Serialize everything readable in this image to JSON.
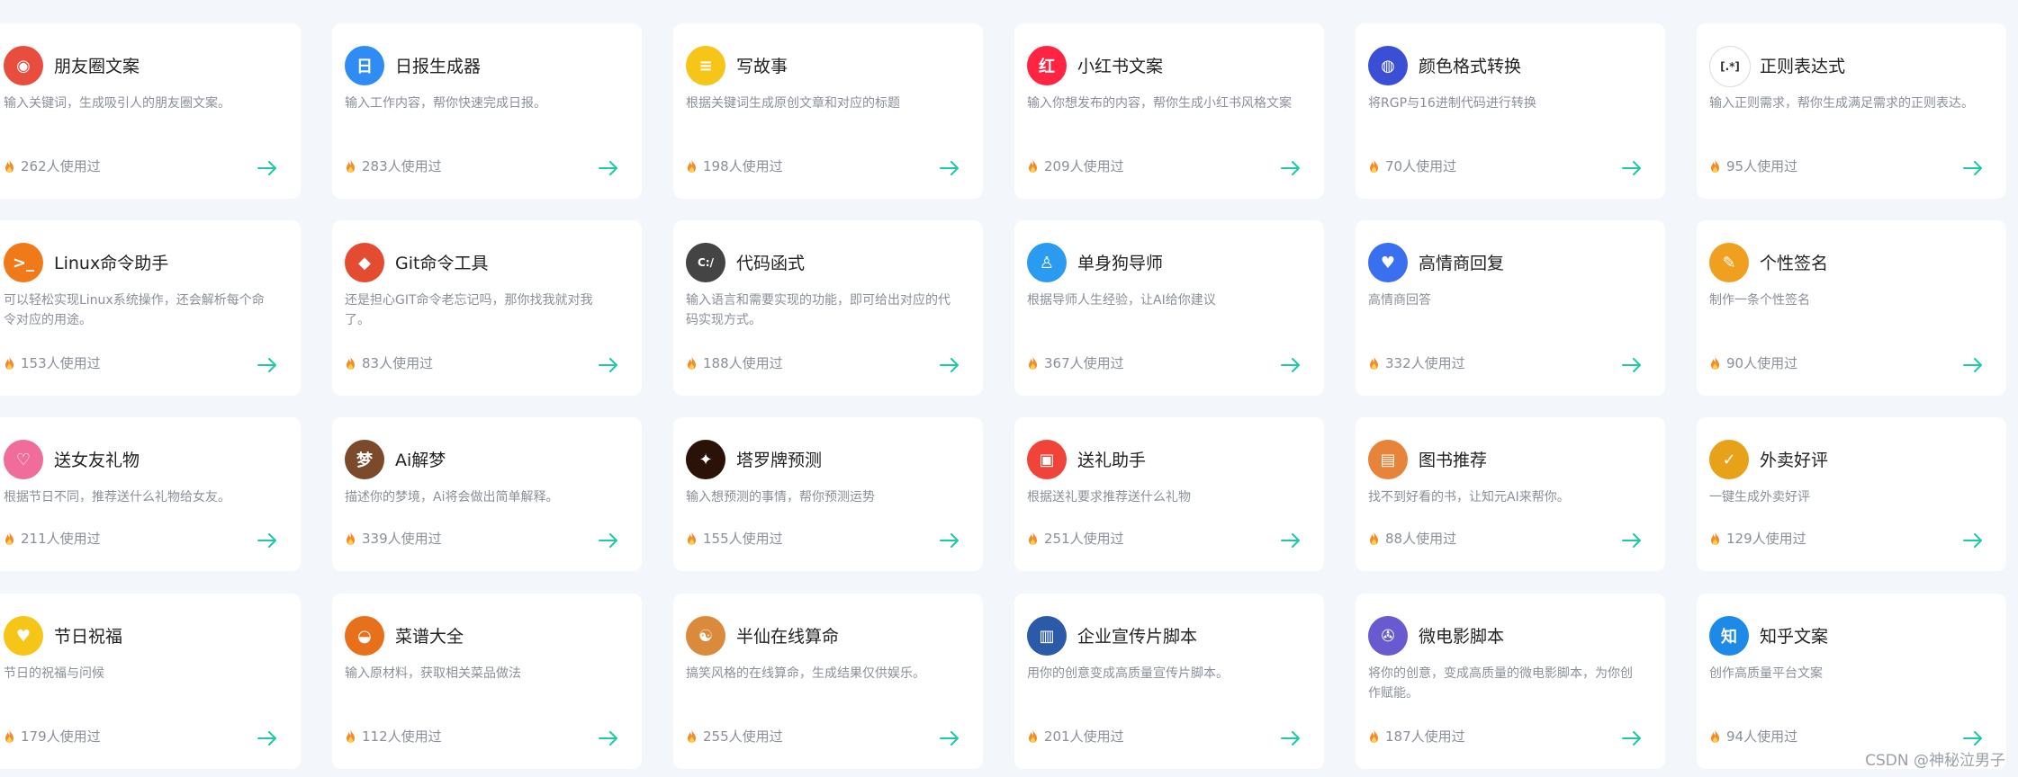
{
  "colors": {
    "accent": "#1ec8a8",
    "fire": "#f28b2c",
    "card": "#ffffff",
    "bg": "#f3f6fb"
  },
  "cards": [
    {
      "title": "朋友圈文案",
      "desc": "输入关键词，生成吸引人的朋友圈文案。",
      "usage": "262人使用过",
      "icon": "colorwheel-icon",
      "color": "#e84d3d",
      "glyph": "◉"
    },
    {
      "title": "日报生成器",
      "desc": "输入工作内容，帮你快速完成日报。",
      "usage": "283人使用过",
      "icon": "calendar-icon",
      "color": "#2f8cf5",
      "glyph": "日"
    },
    {
      "title": "写故事",
      "desc": "根据关键词生成原创文章和对应的标题",
      "usage": "198人使用过",
      "icon": "notepad-icon",
      "color": "#f5c518",
      "glyph": "≡"
    },
    {
      "title": "小红书文案",
      "desc": "输入你想发布的内容，帮你生成小红书风格文案",
      "usage": "209人使用过",
      "icon": "xiaohongshu-icon",
      "color": "#ff2442",
      "glyph": "红"
    },
    {
      "title": "颜色格式转换",
      "desc": "将RGP与16进制代码进行转换",
      "usage": "70人使用过",
      "icon": "palette-icon",
      "color": "#3a4fd6",
      "glyph": "◍"
    },
    {
      "title": "正则表达式",
      "desc": "输入正则需求，帮你生成满足需求的正则表达。",
      "usage": "95人使用过",
      "icon": "regex-icon",
      "color": "#ffffff",
      "glyph": "[.*]"
    },
    {
      "title": "Linux命令助手",
      "desc": "可以轻松实现Linux系统操作，还会解析每个命令对应的用途。",
      "usage": "153人使用过",
      "icon": "terminal-icon",
      "color": "#f07a1a",
      "glyph": ">_"
    },
    {
      "title": "Git命令工具",
      "desc": "还是担心GIT命令老忘记吗，那你找我就对我了。",
      "usage": "83人使用过",
      "icon": "git-icon",
      "color": "#e44c31",
      "glyph": "◆"
    },
    {
      "title": "代码函式",
      "desc": "输入语言和需要实现的功能，即可给出对应的代码实现方式。",
      "usage": "188人使用过",
      "icon": "code-monitor-icon",
      "color": "#444444",
      "glyph": "C:/"
    },
    {
      "title": "单身狗导师",
      "desc": "根据导师人生经验，让AI给你建议",
      "usage": "367人使用过",
      "icon": "id-card-icon",
      "color": "#2a9bf0",
      "glyph": "♙"
    },
    {
      "title": "高情商回复",
      "desc": "高情商回答",
      "usage": "332人使用过",
      "icon": "heart-chat-icon",
      "color": "#3a6ff0",
      "glyph": "♥"
    },
    {
      "title": "个性签名",
      "desc": "制作一条个性签名",
      "usage": "90人使用过",
      "icon": "pencil-icon",
      "color": "#f0a020",
      "glyph": "✎"
    },
    {
      "title": "送女友礼物",
      "desc": "根据节日不同，推荐送什么礼物给女友。",
      "usage": "211人使用过",
      "icon": "couple-icon",
      "color": "#f06c9b",
      "glyph": "♡"
    },
    {
      "title": "Ai解梦",
      "desc": "描述你的梦境，Ai将会做出简单解释。",
      "usage": "339人使用过",
      "icon": "dream-icon",
      "color": "#7a4a2a",
      "glyph": "梦"
    },
    {
      "title": "塔罗牌预测",
      "desc": "输入想预测的事情，帮你预测运势",
      "usage": "155人使用过",
      "icon": "tarot-icon",
      "color": "#2a1208",
      "glyph": "✦"
    },
    {
      "title": "送礼助手",
      "desc": "根据送礼要求推荐送什么礼物",
      "usage": "251人使用过",
      "icon": "gift-icon",
      "color": "#f0433a",
      "glyph": "▣"
    },
    {
      "title": "图书推荐",
      "desc": "找不到好看的书，让知元AI来帮你。",
      "usage": "88人使用过",
      "icon": "book-icon",
      "color": "#e8833a",
      "glyph": "▤"
    },
    {
      "title": "外卖好评",
      "desc": "一键生成外卖好评",
      "usage": "129人使用过",
      "icon": "thumbs-up-icon",
      "color": "#e8a21a",
      "glyph": "✓"
    },
    {
      "title": "节日祝福",
      "desc": "节日的祝福与问候",
      "usage": "179人使用过",
      "icon": "heart-icon",
      "color": "#f5c518",
      "glyph": "♥"
    },
    {
      "title": "菜谱大全",
      "desc": "输入原材料，获取相关菜品做法",
      "usage": "112人使用过",
      "icon": "wok-icon",
      "color": "#e8701a",
      "glyph": "◒"
    },
    {
      "title": "半仙在线算命",
      "desc": "搞笑风格的在线算命，生成结果仅供娱乐。",
      "usage": "255人使用过",
      "icon": "fortune-icon",
      "color": "#d98a3a",
      "glyph": "☯"
    },
    {
      "title": "企业宣传片脚本",
      "desc": "用你的创意变成高质量宣传片脚本。",
      "usage": "201人使用过",
      "icon": "building-icon",
      "color": "#2a5aa8",
      "glyph": "▥"
    },
    {
      "title": "微电影脚本",
      "desc": "将你的创意，变成高质量的微电影脚本，为你创作赋能。",
      "usage": "187人使用过",
      "icon": "film-reel-icon",
      "color": "#6a5ad0",
      "glyph": "✇"
    },
    {
      "title": "知乎文案",
      "desc": "创作高质量平台文案",
      "usage": "94人使用过",
      "icon": "zhihu-icon",
      "color": "#1e8ae8",
      "glyph": "知"
    }
  ],
  "watermark": "CSDN @神秘泣男子"
}
